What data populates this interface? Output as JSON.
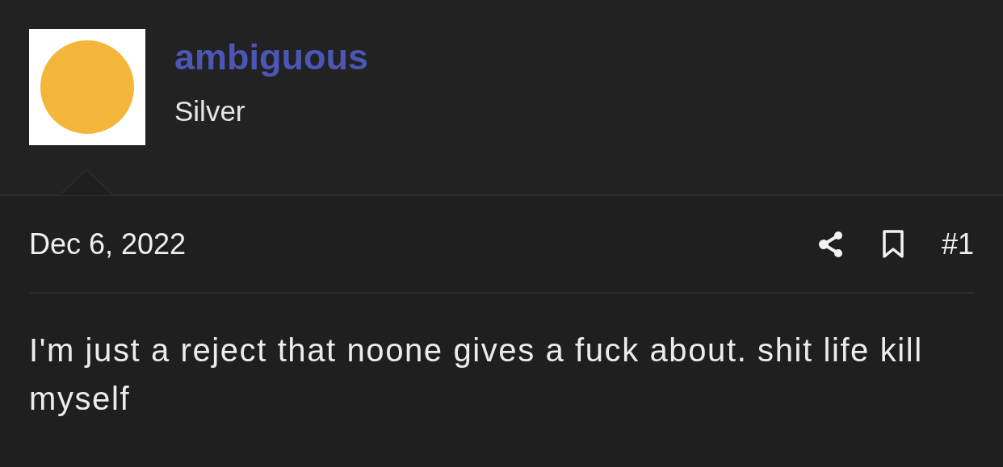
{
  "author": {
    "username": "ambiguous",
    "rank": "Silver"
  },
  "post": {
    "date": "Dec 6, 2022",
    "number": "#1",
    "body": "I'm just a reject that noone gives a fuck about. shit life kill myself"
  }
}
